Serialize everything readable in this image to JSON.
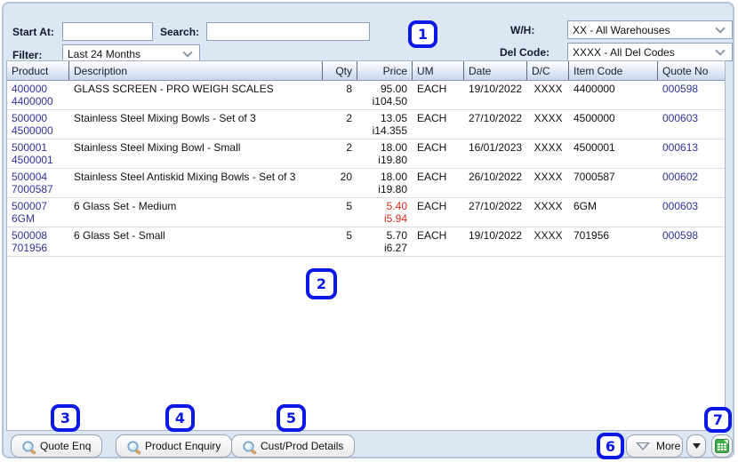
{
  "toolbar": {
    "start_at_label": "Start At:",
    "start_at_value": "",
    "search_label": "Search:",
    "search_value": "",
    "filter_label": "Filter:",
    "filter_value": "Last 24 Months",
    "wh_label": "W/H:",
    "wh_value": "XX - All Warehouses",
    "del_code_label": "Del Code:",
    "del_code_value": "XXXX - All Del Codes"
  },
  "table": {
    "columns": [
      "Product",
      "Description",
      "Qty",
      "Price",
      "UM",
      "Date",
      "D/C",
      "Item Code",
      "Quote No"
    ],
    "rows": [
      {
        "product": "400000",
        "product2": "4400000",
        "description": "GLASS SCREEN - PRO WEIGH SCALES",
        "qty": "8",
        "price": "95.00",
        "price_inc": "i104.50",
        "um": "EACH",
        "date": "19/10/2022",
        "dc": "XXXX",
        "item_code": "4400000",
        "quote_no": "000598",
        "price_red": false
      },
      {
        "product": "500000",
        "product2": "4500000",
        "description": "Stainless Steel Mixing Bowls - Set of 3",
        "qty": "2",
        "price": "13.05",
        "price_inc": "i14.355",
        "um": "EACH",
        "date": "27/10/2022",
        "dc": "XXXX",
        "item_code": "4500000",
        "quote_no": "000603",
        "price_red": false
      },
      {
        "product": "500001",
        "product2": "4500001",
        "description": "Stainless Steel Mixing Bowl - Small",
        "qty": "2",
        "price": "18.00",
        "price_inc": "i19.80",
        "um": "EACH",
        "date": "16/01/2023",
        "dc": "XXXX",
        "item_code": "4500001",
        "quote_no": "000613",
        "price_red": false
      },
      {
        "product": "500004",
        "product2": "7000587",
        "description": "Stainless Steel Antiskid Mixing Bowls - Set of 3",
        "qty": "20",
        "price": "18.00",
        "price_inc": "i19.80",
        "um": "EACH",
        "date": "26/10/2022",
        "dc": "XXXX",
        "item_code": "7000587",
        "quote_no": "000602",
        "price_red": false
      },
      {
        "product": "500007",
        "product2": "6GM",
        "description": "6 Glass Set - Medium",
        "qty": "5",
        "price": "5.40",
        "price_inc": "i5.94",
        "um": "EACH",
        "date": "27/10/2022",
        "dc": "XXXX",
        "item_code": "6GM",
        "quote_no": "000603",
        "price_red": true
      },
      {
        "product": "500008",
        "product2": "701956",
        "description": "6 Glass Set - Small",
        "qty": "5",
        "price": "5.70",
        "price_inc": "i6.27",
        "um": "EACH",
        "date": "19/10/2022",
        "dc": "XXXX",
        "item_code": "701956",
        "quote_no": "000598",
        "price_red": false
      }
    ]
  },
  "footer": {
    "quote_enq_label": "Quote Enq",
    "product_enquiry_label": "Product Enquiry",
    "cust_prod_label": "Cust/Prod Details",
    "more_label": "More"
  },
  "annotations": [
    "1",
    "2",
    "3",
    "4",
    "5",
    "6",
    "7"
  ],
  "colors": {
    "accent_badge_blue": "#0b18e6",
    "link_navy": "#32329b",
    "alert_red": "#d9291c",
    "panel_bg": "#dde7f3"
  }
}
